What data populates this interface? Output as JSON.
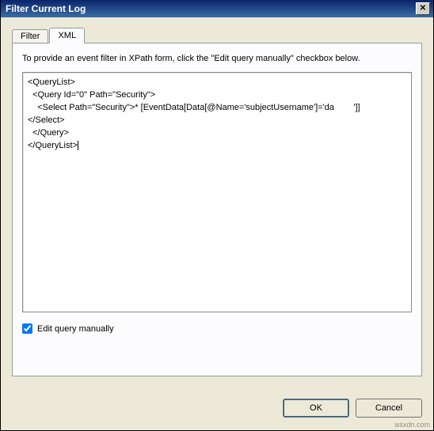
{
  "window": {
    "title": "Filter Current Log",
    "close_glyph": "✕"
  },
  "tabs": {
    "filter": "Filter",
    "xml": "XML"
  },
  "instruction": "To provide an event filter in XPath form, click the \"Edit query manually\" checkbox below.",
  "xml_content": "<QueryList>\n  <Query Id=\"0\" Path=\"Security\">\n    <Select Path=\"Security\">* [EventData[Data[@Name='subjectUsername']='da        ']]\n</Select>\n  </Query>\n</QueryList>",
  "checkbox": {
    "label": "Edit query manually",
    "checked": true
  },
  "buttons": {
    "ok": "OK",
    "cancel": "Cancel"
  },
  "watermark": "wsxdn.com"
}
